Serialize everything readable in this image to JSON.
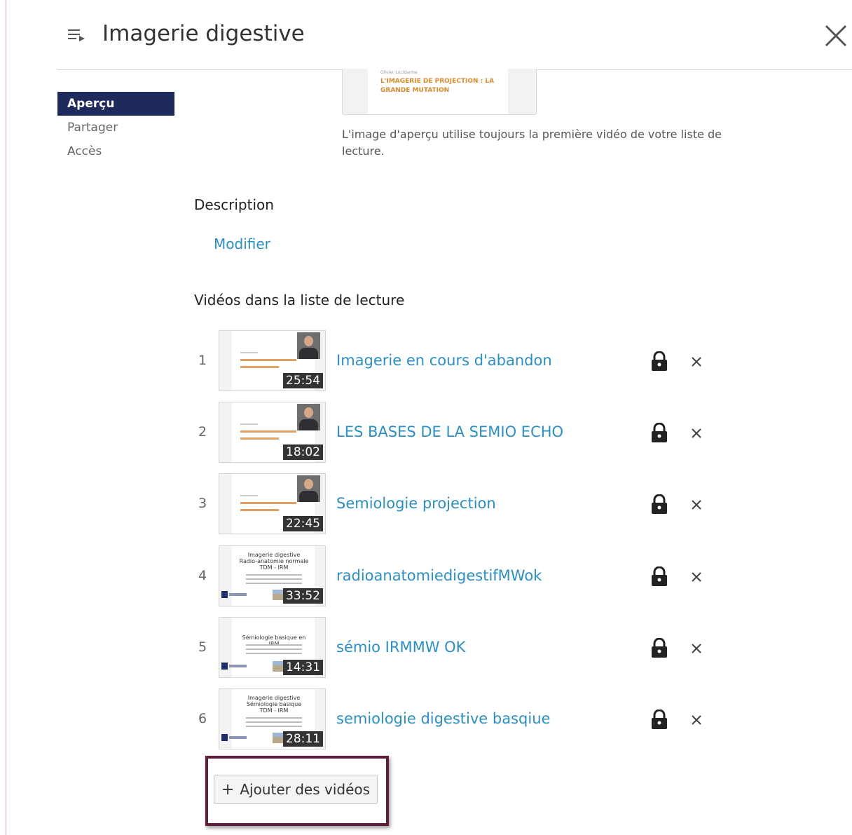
{
  "header": {
    "title": "Imagerie digestive",
    "menu_icon": "playlist-icon",
    "close_icon": "close-icon"
  },
  "sidebar": {
    "items": [
      {
        "label": "Aperçu",
        "active": true
      },
      {
        "label": "Partager",
        "active": false
      },
      {
        "label": "Accès",
        "active": false
      }
    ]
  },
  "preview": {
    "thumbnail_author": "Olivier Lucidarme",
    "thumbnail_title": "L'IMAGERIE DE PROJECTION : LA GRANDE MUTATION",
    "note": "L'image d'aperçu utilise toujours la première vidéo de votre liste de lecture."
  },
  "description": {
    "label": "Description",
    "modify_link": "Modifier"
  },
  "videos": {
    "label": "Vidéos dans la liste de lecture",
    "items": [
      {
        "number": "1",
        "title": "Imagerie en cours d'abandon",
        "duration": "25:54"
      },
      {
        "number": "2",
        "title": "LES BASES DE LA SEMIO ECHO",
        "duration": "18:02"
      },
      {
        "number": "3",
        "title": "Semiologie projection",
        "duration": "22:45"
      },
      {
        "number": "4",
        "title": "radioanatomiedigestifMWok",
        "duration": "33:52",
        "slide_lines": [
          "Imagerie digestive",
          "Radio-anatomie normale",
          "TDM - IRM"
        ]
      },
      {
        "number": "5",
        "title": "sémio IRMMW OK",
        "duration": "14:31",
        "slide_lines": [
          "Sémiologie basique en IRM"
        ]
      },
      {
        "number": "6",
        "title": "semiologie digestive basqiue",
        "duration": "28:11",
        "slide_lines": [
          "Imagerie digestive",
          "Sémiologie basique",
          "TDM - IRM"
        ]
      }
    ]
  },
  "add_button": {
    "icon": "plus-icon",
    "label": "Ajouter des vidéos"
  },
  "colors": {
    "link": "#2b8fc7",
    "active_nav": "#1f2a5c",
    "highlight": "#5e1f3e"
  }
}
